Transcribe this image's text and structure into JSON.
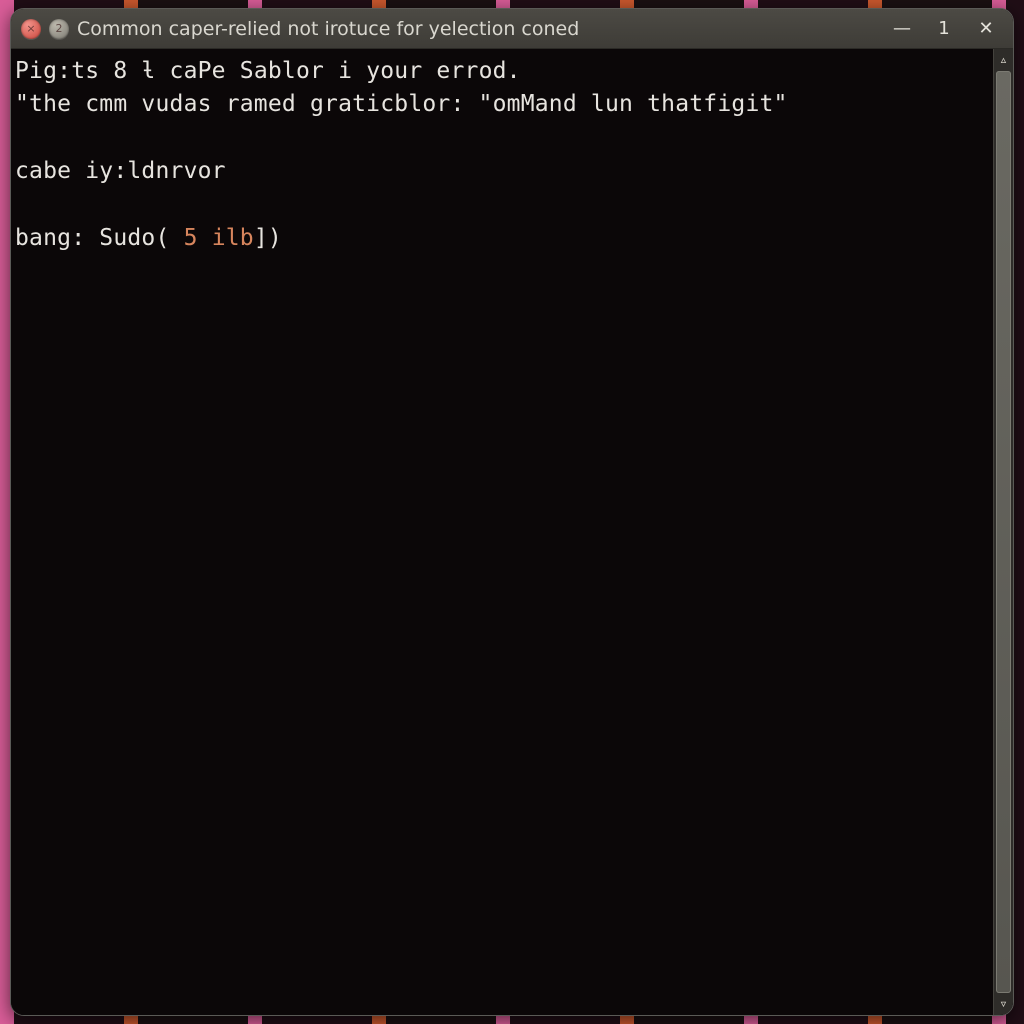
{
  "titlebar": {
    "title": "Common caper-relied not irotuce for yelection coned",
    "badge_close": "×",
    "badge_min": "2",
    "minimize_glyph": "—",
    "window_index": "1",
    "close_glyph": "✕"
  },
  "terminal": {
    "line1_a": "Pig:ts 8 ƚ caPe",
    "line1_b": " Sablor i your errod.",
    "line2": "\"the cmm vudas ramed graticblor: \"omMand lun thatfigit\"",
    "blank": "",
    "line3": "cabe iy:ldnrvor",
    "line4_a": "bang: Sudo( ",
    "line4_num": "5",
    "line4_b": " ",
    "line4_kw": "ilb",
    "line4_c": "])"
  },
  "icons": {
    "scroll_up": "▵",
    "scroll_down": "▿"
  }
}
